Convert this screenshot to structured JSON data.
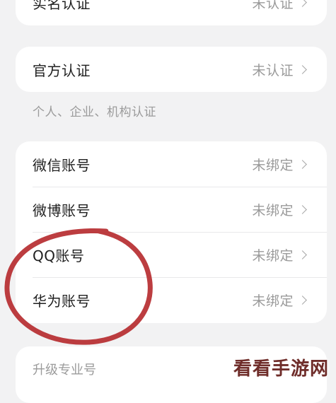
{
  "top_card": {
    "row": {
      "label": "实名认证",
      "value": "未认证"
    }
  },
  "official_card": {
    "row": {
      "label": "官方认证",
      "value": "未认证"
    }
  },
  "section_note": "个人、企业、机构认证",
  "accounts_card": {
    "rows": [
      {
        "label": "微信账号",
        "value": "未绑定"
      },
      {
        "label": "微博账号",
        "value": "未绑定"
      },
      {
        "label": "QQ账号",
        "value": "未绑定"
      },
      {
        "label": "华为账号",
        "value": "未绑定"
      }
    ]
  },
  "upgrade": {
    "label": "升级专业号"
  },
  "watermark": {
    "text": "看看手游网"
  },
  "colors": {
    "background": "#f2f2f3",
    "card": "#ffffff",
    "annotation_circle": "#b5282b",
    "watermark": "#6f2d2a"
  }
}
